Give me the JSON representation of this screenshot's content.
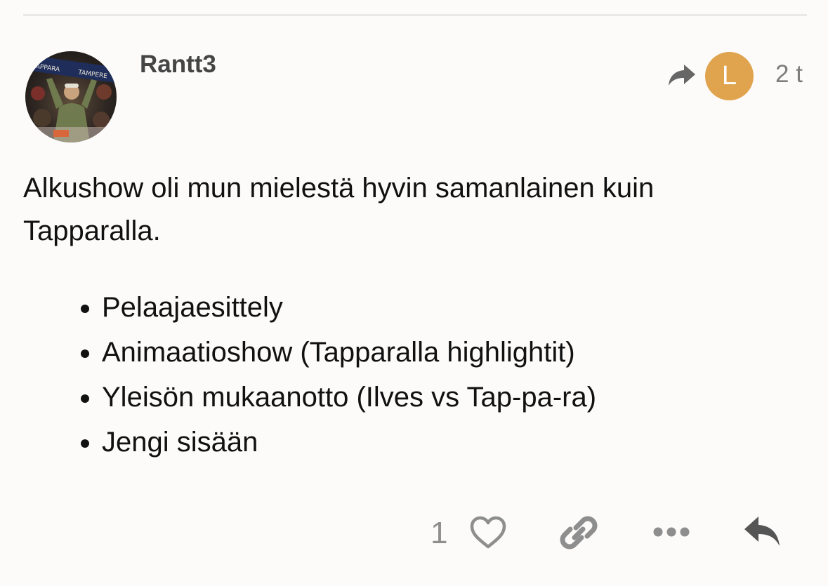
{
  "post": {
    "username": "Rantt3",
    "reply_to_avatar_letter": "L",
    "time": "2 t",
    "paragraph": "Alkushow oli mun mielestä hyvin samanlainen kuin Tapparalla.",
    "list_items": [
      "Pelaajaesittely",
      "Animaatioshow (Tapparalla highlightit)",
      "Yleisön mukaanotto (Ilves vs Tap-pa-ra)",
      "Jengi sisään"
    ],
    "avatar_banner_text": [
      "TAPPARA",
      "TAMPERE"
    ]
  },
  "actions": {
    "like_count": "1"
  },
  "colors": {
    "background": "#fcfbfa",
    "reply_avatar": "#e1a44e",
    "muted_icon": "#8e8e8e",
    "reply_icon": "#555555"
  },
  "icons": {
    "reply_to": "share-arrow-icon",
    "like": "heart-icon",
    "link": "link-icon",
    "more": "ellipsis-icon",
    "reply": "reply-icon"
  }
}
